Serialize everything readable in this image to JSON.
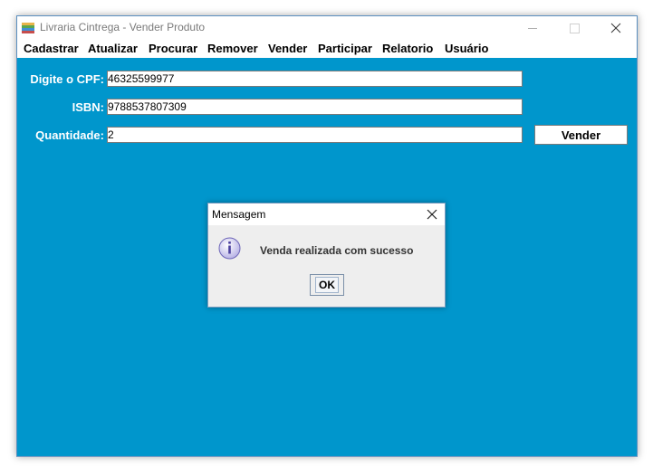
{
  "window": {
    "title": "Livraria Cintrega - Vender Produto",
    "icons": {
      "app": "books-icon",
      "minimize": "minimize-icon",
      "maximize": "maximize-icon",
      "close": "close-icon"
    }
  },
  "menu": {
    "items": [
      "Cadastrar",
      "Atualizar",
      "Procurar",
      "Remover",
      "Vender",
      "Participar",
      "Relatorio",
      "Usuário"
    ]
  },
  "form": {
    "cpf_label": "Digite o CPF:",
    "cpf_value": "46325599977",
    "isbn_label": "ISBN:",
    "isbn_value": "9788537807309",
    "quantity_label": "Quantidade:",
    "quantity_value": "2",
    "sell_button": "Vender"
  },
  "dialog": {
    "title": "Mensagem",
    "message": "Venda realizada com sucesso",
    "ok_button": "OK",
    "icon": "info-icon"
  },
  "colors": {
    "content_background": "#0096cc",
    "label_text": "#ffffff"
  }
}
